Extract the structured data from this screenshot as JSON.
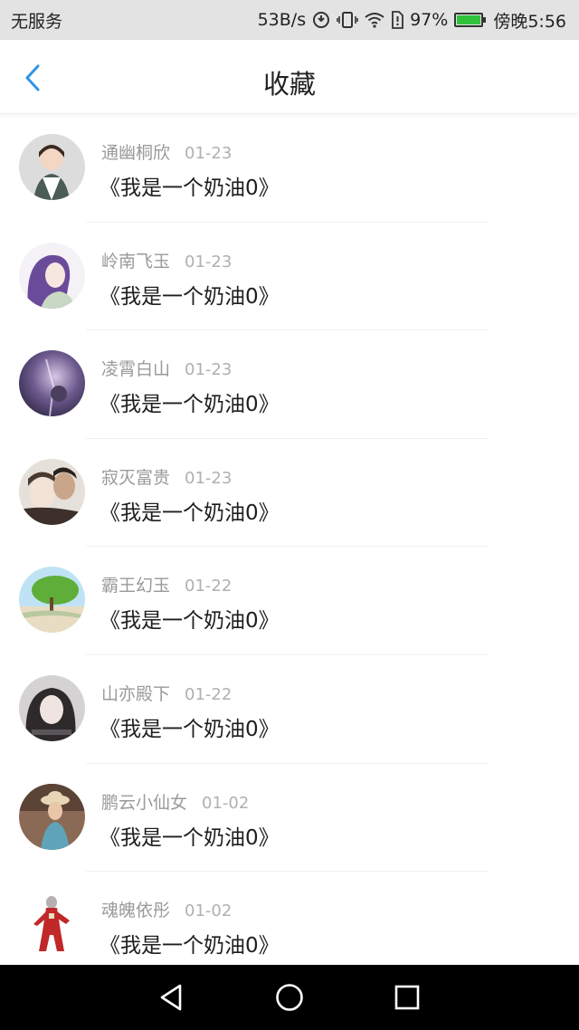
{
  "status_bar": {
    "carrier": "无服务",
    "speed": "53B/s",
    "battery_pct": "97%",
    "battery_level": 0.97,
    "time": "傍晚5:56",
    "icons": [
      "data-saver-icon",
      "vibrate-icon",
      "wifi-icon",
      "sim-alert-icon",
      "battery-icon"
    ]
  },
  "header": {
    "title": "收藏",
    "back_icon": "chevron-left-icon",
    "accent_color": "#2f95e8"
  },
  "list": {
    "items": [
      {
        "user": "通幽桐欣",
        "date": "01-23",
        "title": "《我是一个奶油0》"
      },
      {
        "user": "岭南飞玉",
        "date": "01-23",
        "title": "《我是一个奶油0》"
      },
      {
        "user": "凌霄白山",
        "date": "01-23",
        "title": "《我是一个奶油0》"
      },
      {
        "user": "寂灭富贵",
        "date": "01-23",
        "title": "《我是一个奶油0》"
      },
      {
        "user": "霸王幻玉",
        "date": "01-22",
        "title": "《我是一个奶油0》"
      },
      {
        "user": "山亦殿下",
        "date": "01-22",
        "title": "《我是一个奶油0》"
      },
      {
        "user": "鹏云小仙女",
        "date": "01-02",
        "title": "《我是一个奶油0》"
      },
      {
        "user": "魂魄依彤",
        "date": "01-02",
        "title": "《我是一个奶油0》"
      }
    ]
  },
  "system_nav": {
    "icons": [
      "back-triangle-icon",
      "home-circle-icon",
      "recents-square-icon"
    ]
  }
}
